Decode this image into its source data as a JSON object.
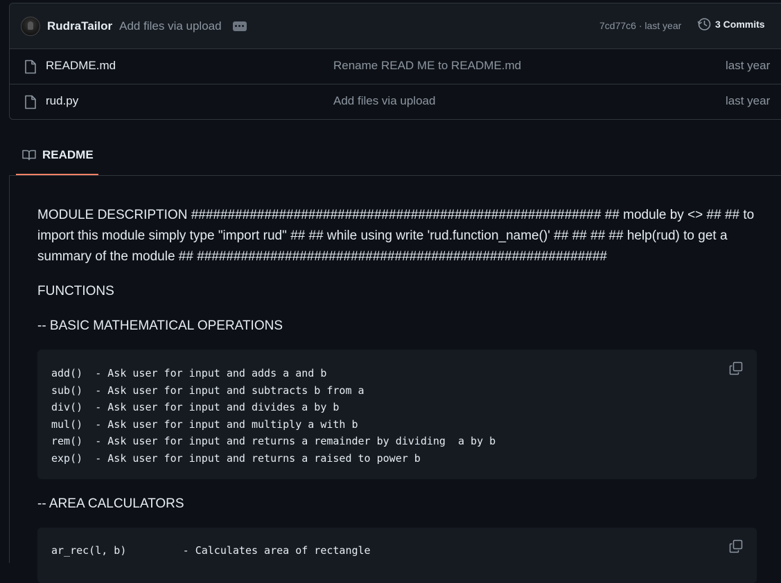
{
  "commit_bar": {
    "author": "RudraTailor",
    "message": "Add files via upload",
    "hash_time": "7cd77c6 · last year",
    "commits_label": "3 Commits"
  },
  "files": [
    {
      "name": "README.md",
      "message": "Rename READ ME to README.md",
      "date": "last year"
    },
    {
      "name": "rud.py",
      "message": "Add files via upload",
      "date": "last year"
    }
  ],
  "readme_tab": {
    "label": "README"
  },
  "readme": {
    "description": "MODULE DESCRIPTION ######################################################## ## module by <> ## ## to import this module simply type \"import rud\" ## ## while using write 'rud.function_name()' ## ## ## ## help(rud) to get a summary of the module ## ########################################################",
    "functions_heading": "FUNCTIONS",
    "basic_heading": "-- BASIC MATHEMATICAL OPERATIONS",
    "basic_code": [
      "add()  - Ask user for input and adds a and b",
      "sub()  - Ask user for input and subtracts b from a",
      "div()  - Ask user for input and divides a by b",
      "mul()  - Ask user for input and multiply a with b",
      "rem()  - Ask user for input and returns a remainder by dividing  a by b",
      "exp()  - Ask user for input and returns a raised to power b"
    ],
    "area_heading": "-- AREA CALCULATORS",
    "area_code": [
      "ar_rec(l, b)         - Calculates area of rectangle"
    ]
  }
}
